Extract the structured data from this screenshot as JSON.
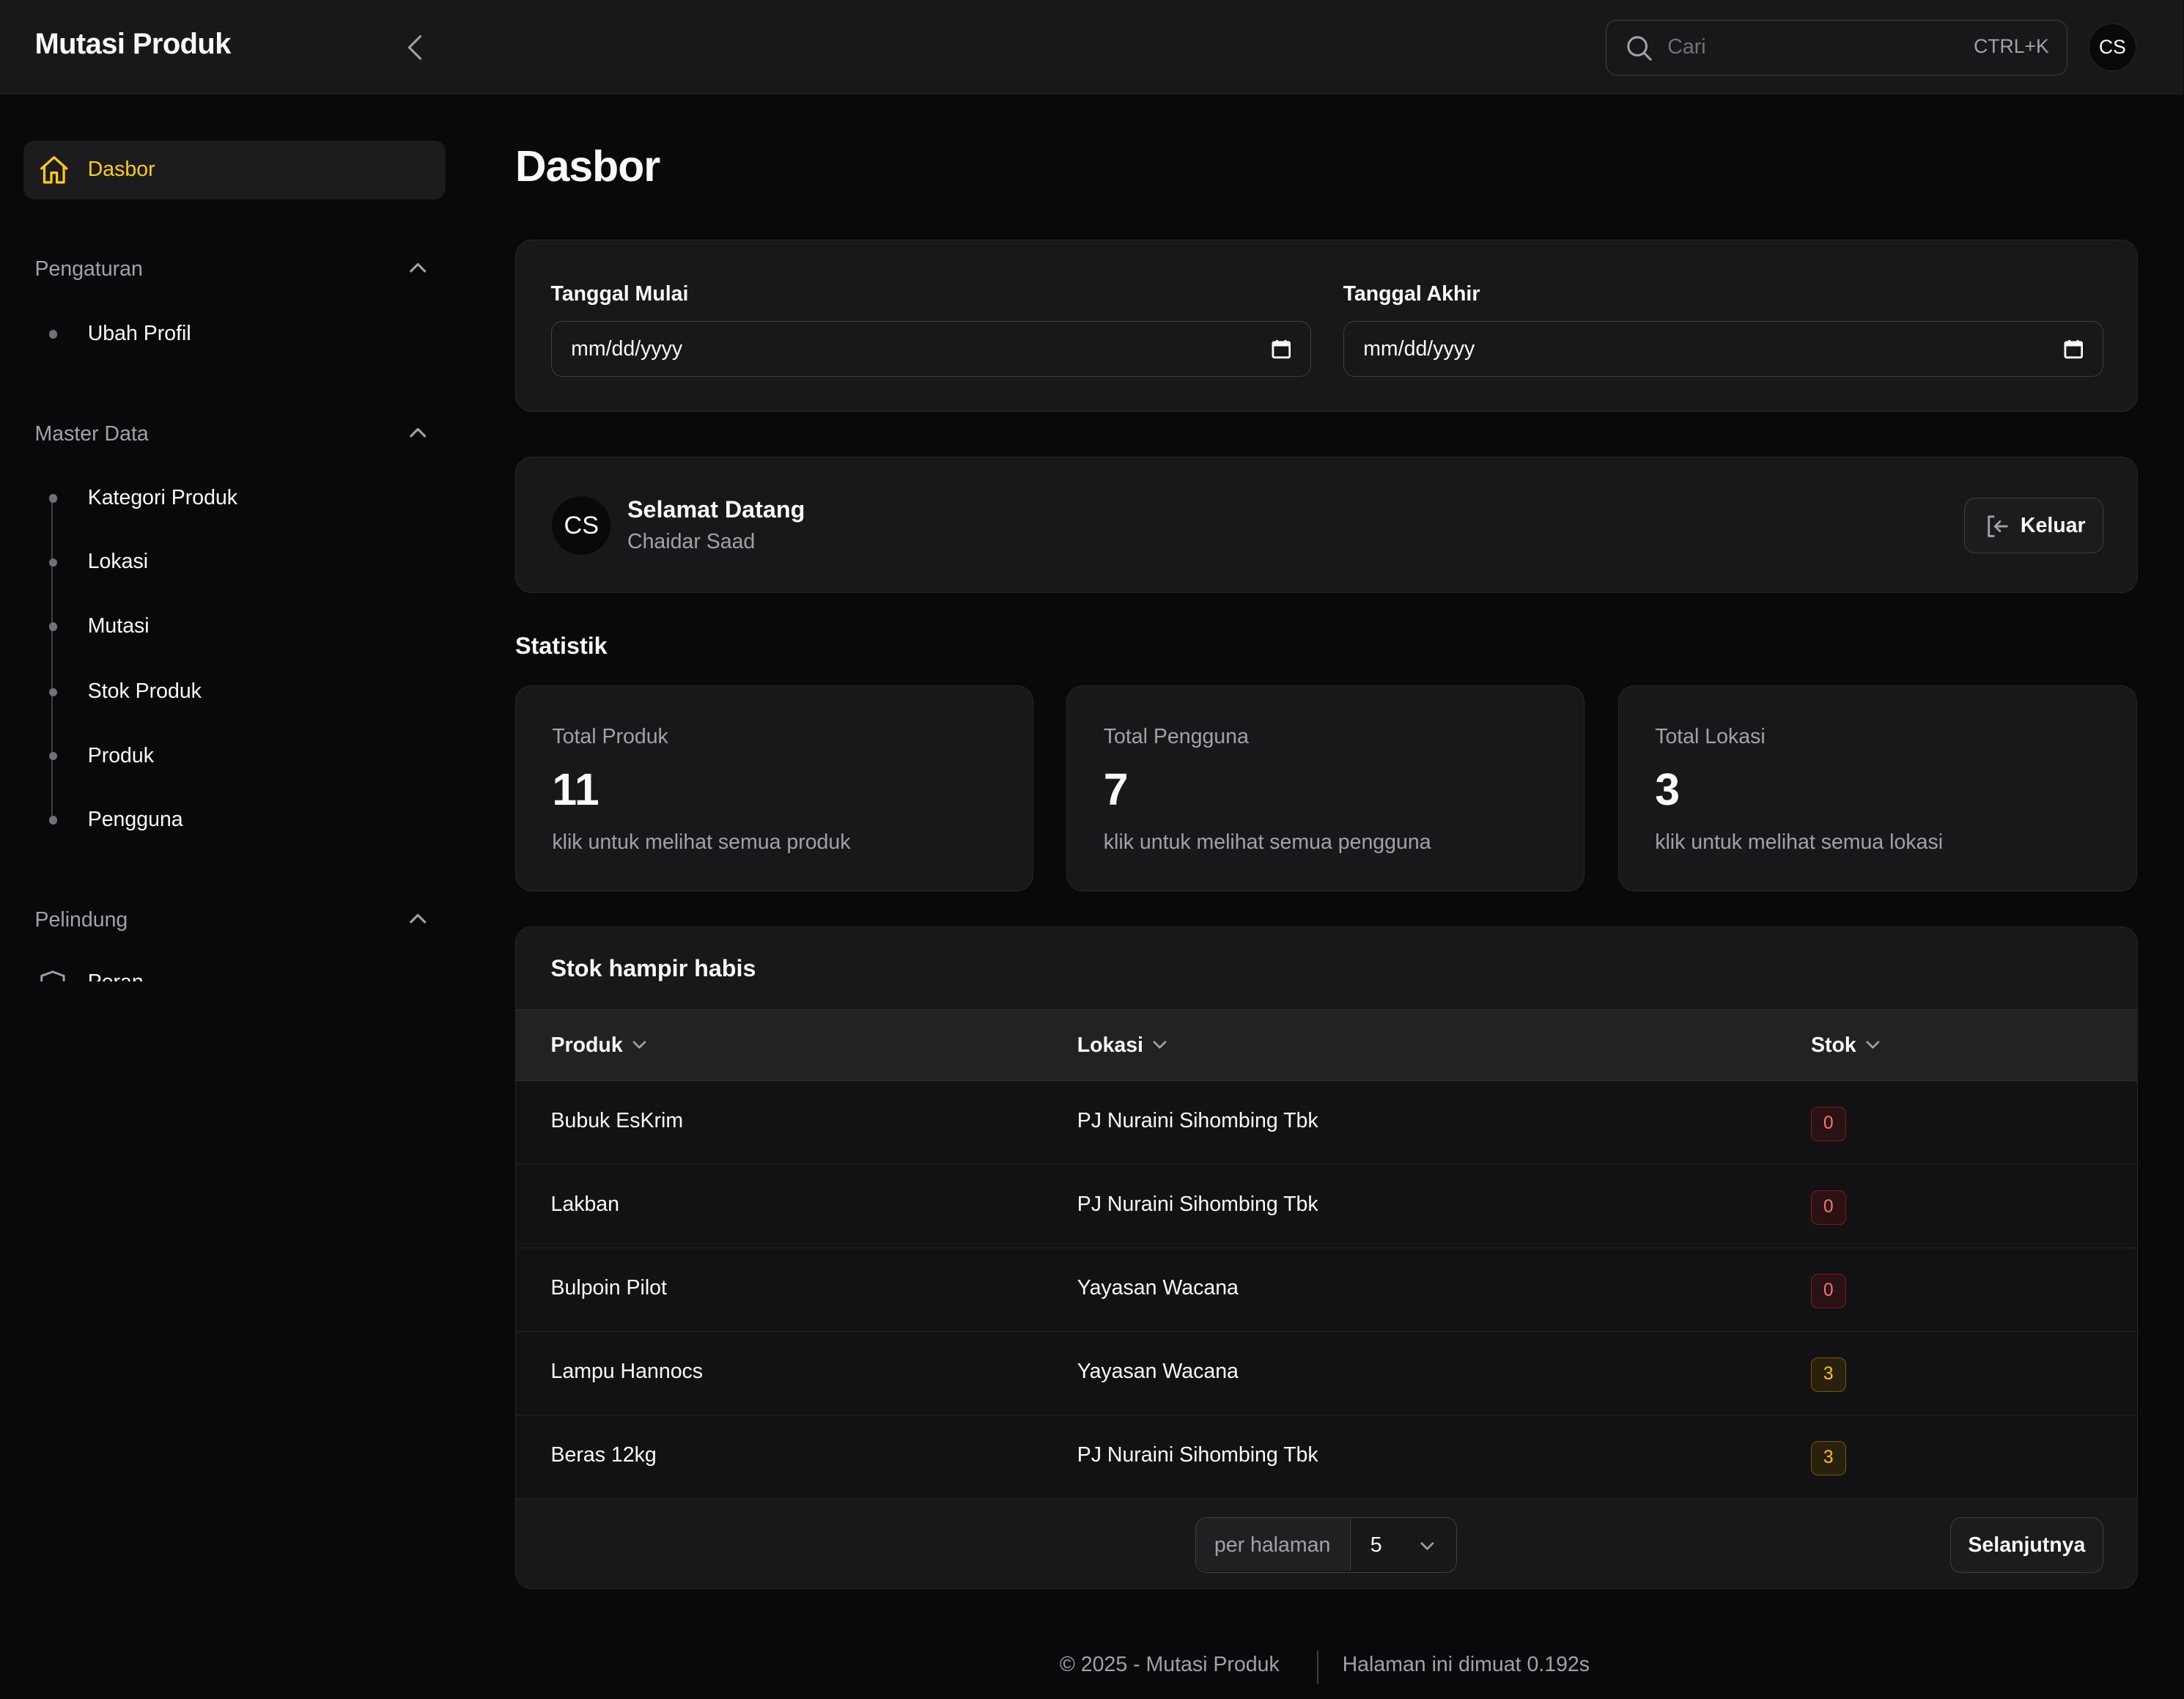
{
  "app": {
    "title": "Mutasi Produk"
  },
  "header": {
    "search_placeholder": "Cari",
    "search_shortcut": "CTRL+K",
    "avatar_initials": "CS"
  },
  "sidebar": {
    "active_item": "Dasbor",
    "groups": [
      {
        "title": "Pengaturan",
        "items": [
          "Ubah Profil"
        ]
      },
      {
        "title": "Master Data",
        "items": [
          "Kategori Produk",
          "Lokasi",
          "Mutasi",
          "Stok Produk",
          "Produk",
          "Pengguna"
        ]
      },
      {
        "title": "Pelindung",
        "items": [
          "Peran"
        ]
      }
    ]
  },
  "main": {
    "page_title": "Dasbor",
    "filters": {
      "start_label": "Tanggal Mulai",
      "start_value": "mm/dd/yyyy",
      "end_label": "Tanggal Akhir",
      "end_value": "mm/dd/yyyy"
    },
    "welcome": {
      "initials": "CS",
      "greeting": "Selamat Datang",
      "user_name": "Chaidar Saad",
      "logout_label": "Keluar"
    },
    "stats_title": "Statistik",
    "stats": [
      {
        "label": "Total Produk",
        "value": "11",
        "desc": "klik untuk melihat semua produk"
      },
      {
        "label": "Total Pengguna",
        "value": "7",
        "desc": "klik untuk melihat semua pengguna"
      },
      {
        "label": "Total Lokasi",
        "value": "3",
        "desc": "klik untuk melihat semua lokasi"
      }
    ],
    "low_stock": {
      "title": "Stok hampir habis",
      "columns": [
        "Produk",
        "Lokasi",
        "Stok"
      ],
      "rows": [
        {
          "produk": "Bubuk EsKrim",
          "lokasi": "PJ Nuraini Sihombing Tbk",
          "stok": "0",
          "status": "danger"
        },
        {
          "produk": "Lakban",
          "lokasi": "PJ Nuraini Sihombing Tbk",
          "stok": "0",
          "status": "danger"
        },
        {
          "produk": "Bulpoin Pilot",
          "lokasi": "Yayasan Wacana",
          "stok": "0",
          "status": "danger"
        },
        {
          "produk": "Lampu Hannocs",
          "lokasi": "Yayasan Wacana",
          "stok": "3",
          "status": "warning"
        },
        {
          "produk": "Beras 12kg",
          "lokasi": "PJ Nuraini Sihombing Tbk",
          "stok": "3",
          "status": "warning"
        }
      ],
      "per_page_label": "per halaman",
      "per_page_value": "5",
      "next_label": "Selanjutnya"
    }
  },
  "footer": {
    "copyright": "© 2025 - Mutasi Produk",
    "load_time": "Halaman ini dimuat 0.192s"
  },
  "colors": {
    "accent": "#facc15",
    "danger": "#f87171",
    "warning": "#fbbf24",
    "background": "#09090b",
    "surface": "#18181b"
  }
}
